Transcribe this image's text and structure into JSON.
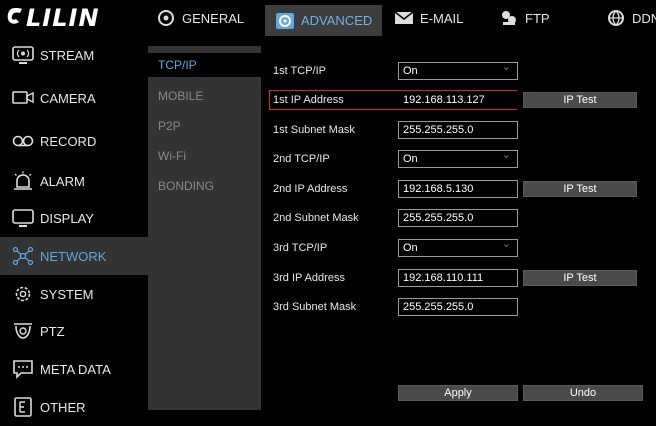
{
  "app": {
    "logo_text": "LILIN"
  },
  "topnav": {
    "tabs": [
      {
        "label": "GENERAL",
        "icon": "gear-icon"
      },
      {
        "label": "ADVANCED",
        "icon": "advanced-gear-icon",
        "active": true
      },
      {
        "label": "E-MAIL",
        "icon": "envelope-icon"
      },
      {
        "label": "FTP",
        "icon": "ftp-icon"
      },
      {
        "label": "DDNS",
        "icon": "globe-icon"
      }
    ]
  },
  "sidebar": {
    "items": [
      {
        "label": "STREAM",
        "icon": "stream-icon"
      },
      {
        "label": "CAMERA",
        "icon": "camera-icon"
      },
      {
        "label": "RECORD",
        "icon": "record-icon"
      },
      {
        "label": "ALARM",
        "icon": "alarm-icon"
      },
      {
        "label": "DISPLAY",
        "icon": "display-icon"
      },
      {
        "label": "NETWORK",
        "icon": "network-icon",
        "active": true
      },
      {
        "label": "SYSTEM",
        "icon": "system-icon"
      },
      {
        "label": "PTZ",
        "icon": "ptz-icon"
      },
      {
        "label": "META DATA",
        "icon": "metadata-icon"
      },
      {
        "label": "OTHER",
        "icon": "other-icon"
      }
    ]
  },
  "submenu": {
    "items": [
      {
        "label": "TCP/IP",
        "active": true
      },
      {
        "label": "MOBILE"
      },
      {
        "label": "P2P"
      },
      {
        "label": "Wi-Fi"
      },
      {
        "label": "BONDING"
      }
    ]
  },
  "form": {
    "rows": [
      {
        "label": "1st TCP/IP",
        "value": "On",
        "type": "select"
      },
      {
        "label": "1st IP Address",
        "value": "192.168.113.127",
        "type": "text",
        "button": "IP Test",
        "highlighted": true
      },
      {
        "label": "1st Subnet Mask",
        "value": "255.255.255.0",
        "type": "text"
      },
      {
        "label": "2nd TCP/IP",
        "value": "On",
        "type": "select"
      },
      {
        "label": "2nd IP Address",
        "value": "192.168.5.130",
        "type": "text",
        "button": "IP Test"
      },
      {
        "label": "2nd Subnet Mask",
        "value": "255.255.255.0",
        "type": "text"
      },
      {
        "label": "3rd TCP/IP",
        "value": "On",
        "type": "select"
      },
      {
        "label": "3rd IP Address",
        "value": "192.168.110.111",
        "type": "text",
        "button": "IP Test"
      },
      {
        "label": "3rd Subnet Mask",
        "value": "255.255.255.0",
        "type": "text"
      }
    ],
    "apply_label": "Apply",
    "undo_label": "Undo"
  },
  "colors": {
    "accent": "#5fa8e0",
    "highlight_border": "#d12a2a"
  }
}
